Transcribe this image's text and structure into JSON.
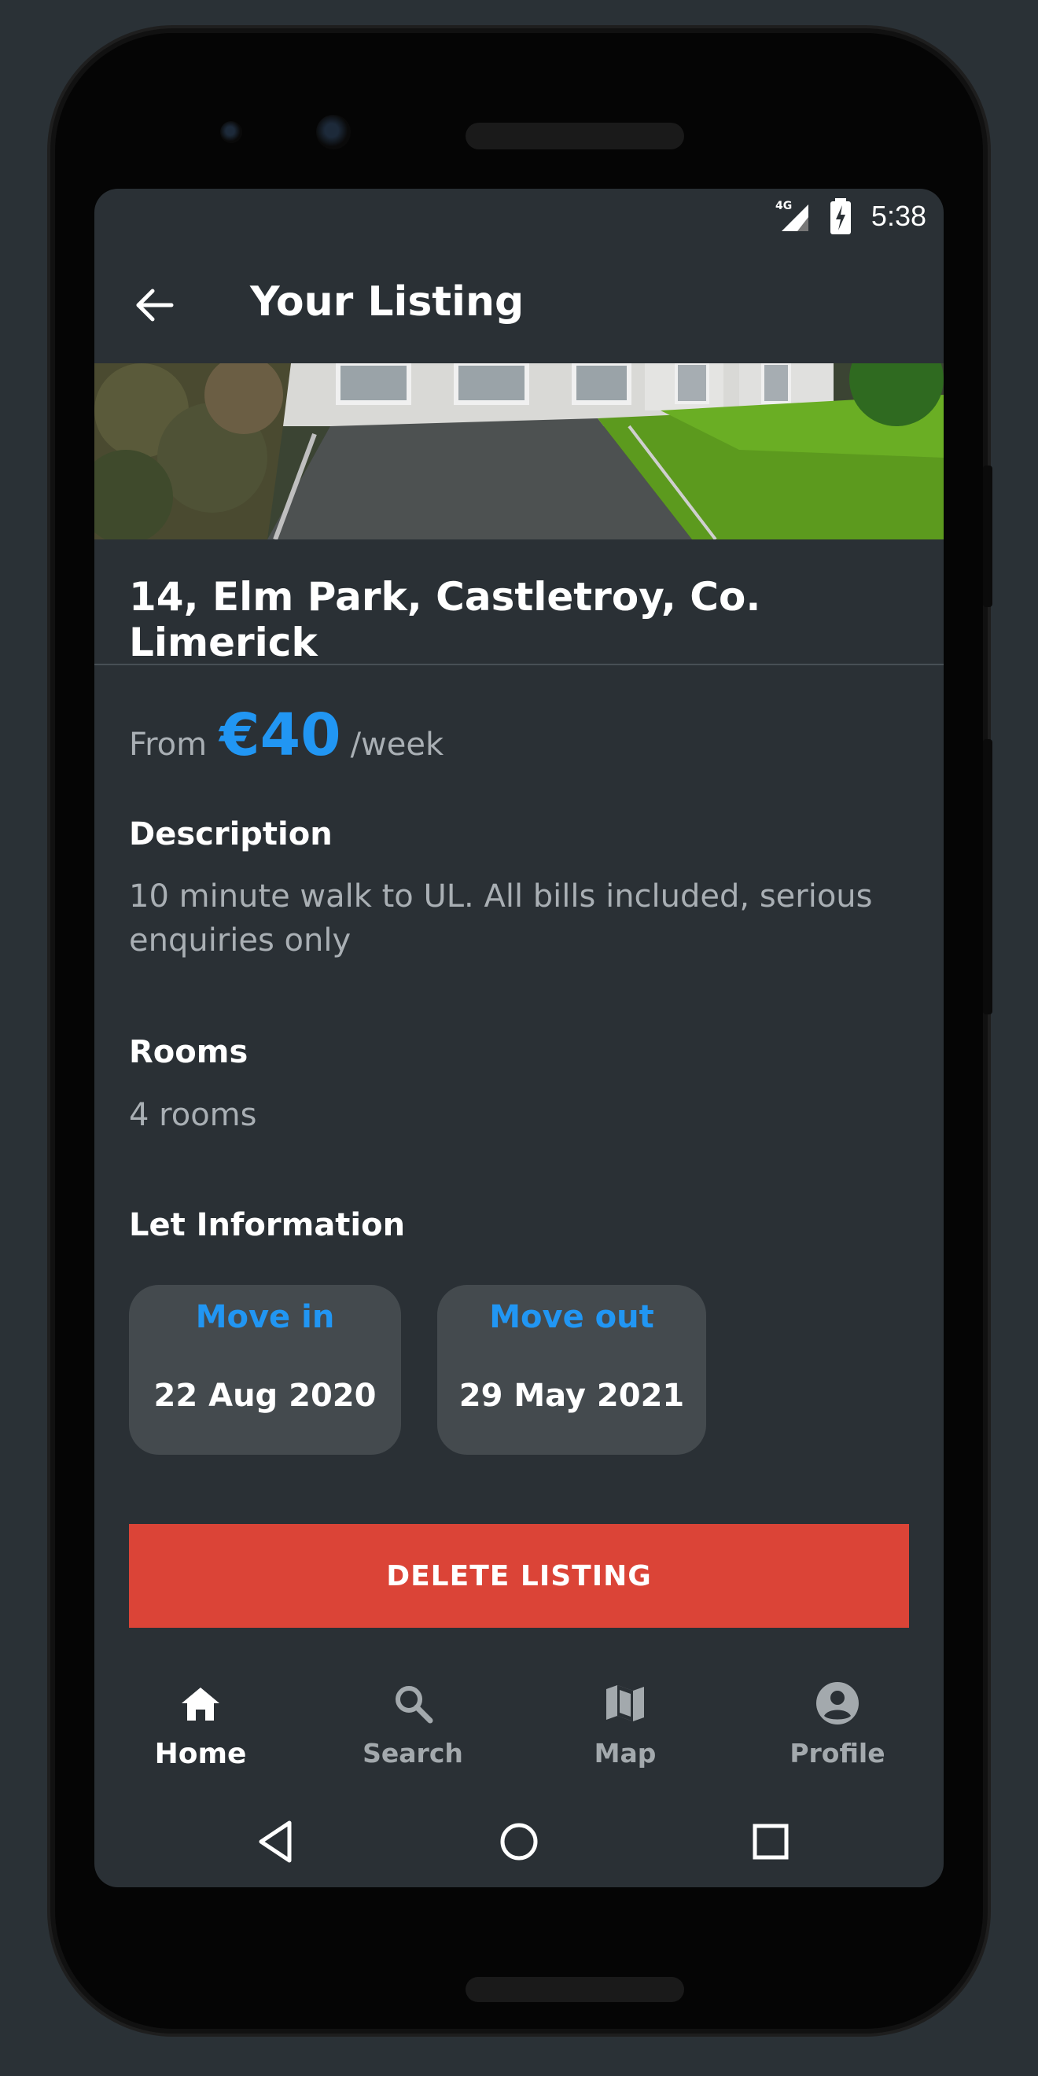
{
  "status_bar": {
    "time": "5:38",
    "network": "4G"
  },
  "app_bar": {
    "title": "Your Listing",
    "back_icon": "arrow-back-icon"
  },
  "listing": {
    "address": "14, Elm Park, Castletroy, Co. Limerick",
    "price": {
      "prefix": "From",
      "value": "€40",
      "unit": "/week"
    },
    "description": {
      "title": "Description",
      "text": "10 minute walk to UL. All bills included, serious enquiries only"
    },
    "rooms": {
      "title": "Rooms",
      "text": "4 rooms"
    },
    "let_information": {
      "title": "Let Information",
      "move_in": {
        "label": "Move in",
        "date": "22 Aug 2020"
      },
      "move_out": {
        "label": "Move out",
        "date": "29 May 2021"
      }
    },
    "delete_label": "DELETE LISTING"
  },
  "bottom_nav": {
    "items": [
      {
        "label": "Home",
        "icon": "home-icon",
        "active": true
      },
      {
        "label": "Search",
        "icon": "search-icon",
        "active": false
      },
      {
        "label": "Map",
        "icon": "map-icon",
        "active": false
      },
      {
        "label": "Profile",
        "icon": "account-circle-icon",
        "active": false
      }
    ]
  },
  "system_nav": {
    "icons": [
      "back-triangle-icon",
      "home-circle-icon",
      "recents-square-icon"
    ]
  },
  "colors": {
    "background": "#2a3035",
    "accent": "#2196f3",
    "danger": "#db4437",
    "card": "#444a4e",
    "muted_text": "#a9afb4"
  }
}
